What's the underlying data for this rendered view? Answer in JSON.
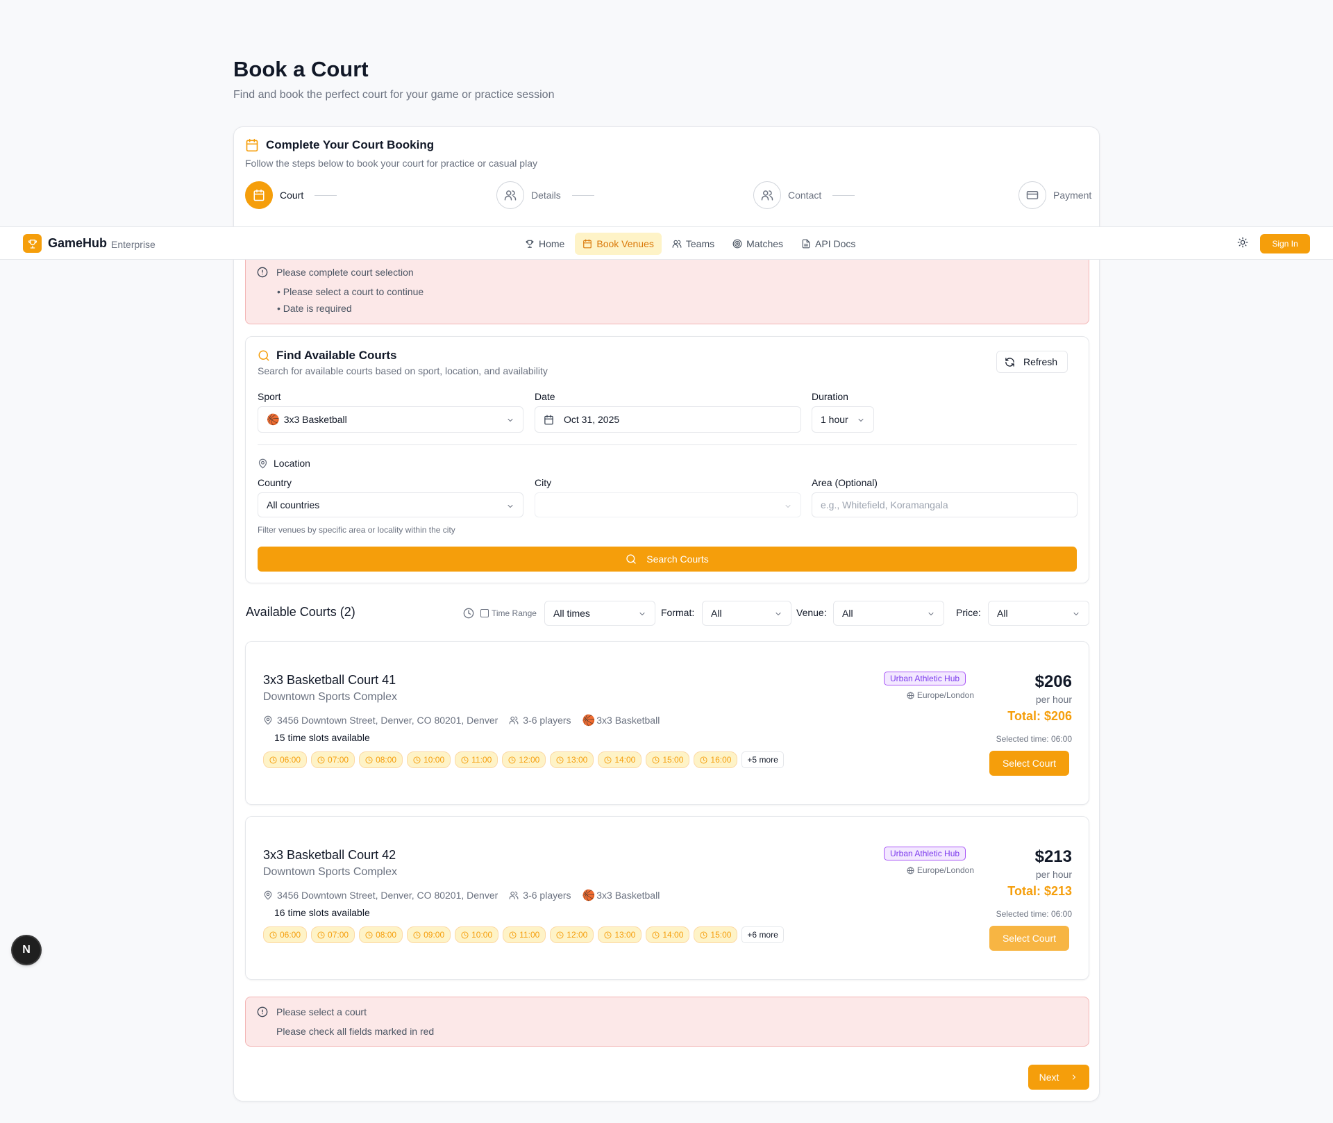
{
  "page": {
    "title": "Book a Court",
    "subtitle": "Find and book the perfect court for your game or practice session"
  },
  "wizard": {
    "title": "Complete Your Court Booking",
    "subtitle": "Follow the steps below to book your court for practice or casual play",
    "steps": [
      {
        "label": "Court",
        "icon": "calendar-icon",
        "active": true
      },
      {
        "label": "Details",
        "icon": "users-icon",
        "active": false
      },
      {
        "label": "Contact",
        "icon": "users-icon",
        "active": false
      },
      {
        "label": "Payment",
        "icon": "credit-card-icon",
        "active": false
      }
    ]
  },
  "navbar": {
    "brand": "GameHub",
    "brand_sub": "Enterprise",
    "items": [
      {
        "label": "Home",
        "icon": "trophy-icon",
        "active": false
      },
      {
        "label": "Book Venues",
        "icon": "calendar-icon",
        "active": true
      },
      {
        "label": "Teams",
        "icon": "users-icon",
        "active": false
      },
      {
        "label": "Matches",
        "icon": "target-icon",
        "active": false
      },
      {
        "label": "API Docs",
        "icon": "file-icon",
        "active": false
      }
    ],
    "sign_in": "Sign In"
  },
  "alert_top": {
    "title": "Please complete court selection",
    "items": [
      "• Please select a court to continue",
      "• Date is required"
    ]
  },
  "search": {
    "title": "Find Available Courts",
    "subtitle": "Search for available courts based on sport, location, and availability",
    "refresh": "Refresh",
    "sport_label": "Sport",
    "sport_icon": "🏀",
    "sport_value": "3x3 Basketball",
    "date_label": "Date",
    "date_value": "Oct 31, 2025",
    "duration_label": "Duration",
    "duration_value": "1 hour",
    "location_label": "Location",
    "country_label": "Country",
    "country_value": "All countries",
    "city_label": "City",
    "city_value": "",
    "area_label": "Area (Optional)",
    "area_placeholder": "e.g., Whitefield, Koramangala",
    "help": "Filter venues by specific area or locality within the city",
    "button": "Search Courts"
  },
  "available": {
    "title": "Available Courts (2)",
    "time_range_label": "Time Range",
    "times_value": "All times",
    "format_label": "Format:",
    "format_value": "All",
    "venue_label": "Venue:",
    "venue_value": "All",
    "price_label": "Price:",
    "price_value": "All"
  },
  "courts": [
    {
      "name": "3x3 Basketball Court 41",
      "venue": "Downtown Sports Complex",
      "address": "3456 Downtown Street, Denver, CO 80201, Denver",
      "players": "3-6 players",
      "sport": "3x3 Basketball",
      "sport_icon": "🏀",
      "slots_count": "15 time slots available",
      "slots": [
        "06:00",
        "07:00",
        "08:00",
        "10:00",
        "11:00",
        "12:00",
        "13:00",
        "14:00",
        "15:00",
        "16:00"
      ],
      "more": "+5 more",
      "tag": "Urban Athletic Hub",
      "timezone": "Europe/London",
      "price": "$206",
      "per_hour": "per hour",
      "total": "Total: $206",
      "selected_time": "Selected time: 06:00",
      "button": "Select Court"
    },
    {
      "name": "3x3 Basketball Court 42",
      "venue": "Downtown Sports Complex",
      "address": "3456 Downtown Street, Denver, CO 80201, Denver",
      "players": "3-6 players",
      "sport": "3x3 Basketball",
      "sport_icon": "🏀",
      "slots_count": "16 time slots available",
      "slots": [
        "06:00",
        "07:00",
        "08:00",
        "09:00",
        "10:00",
        "11:00",
        "12:00",
        "13:00",
        "14:00",
        "15:00"
      ],
      "more": "+6 more",
      "tag": "Urban Athletic Hub",
      "timezone": "Europe/London",
      "price": "$213",
      "per_hour": "per hour",
      "total": "Total: $213",
      "selected_time": "Selected time: 06:00",
      "button": "Select Court"
    }
  ],
  "alert_bottom": {
    "title": "Please select a court",
    "detail": "Please check all fields marked in red"
  },
  "next": "Next",
  "dev_badge": "N",
  "colors": {
    "accent": "#f59e0b",
    "alert_bg": "#fce8e8",
    "tag_purple": "#7c3aed"
  }
}
